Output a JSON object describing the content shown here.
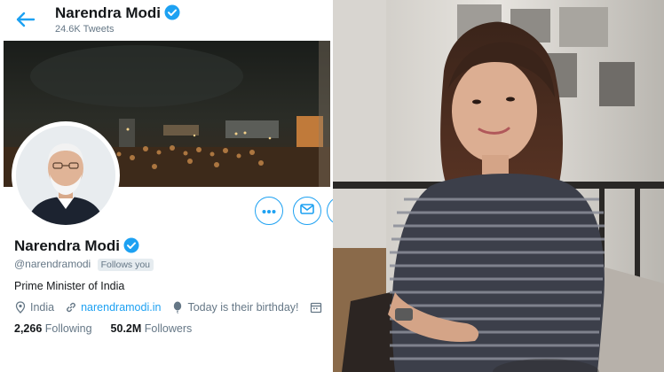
{
  "header": {
    "name": "Narendra Modi",
    "tweet_count": "24.6K Tweets"
  },
  "profile": {
    "name": "Narendra Modi",
    "handle": "@narendramodi",
    "follows_badge": "Follows you",
    "bio": "Prime Minister of India",
    "location": "India",
    "website": "narendramodi.in",
    "birthday_note": "Today is their birthday!",
    "following_count": "2,266",
    "following_label": "Following",
    "followers_count": "50.2M",
    "followers_label": "Followers"
  },
  "icons": {
    "back": "arrow-left-icon",
    "verified": "verified-badge-icon",
    "more": "more-icon",
    "message": "envelope-icon",
    "location": "location-pin-icon",
    "link": "link-icon",
    "balloon": "balloon-icon",
    "calendar": "calendar-icon"
  },
  "colors": {
    "accent": "#1da1f2",
    "text_primary": "#14171a",
    "text_secondary": "#657786"
  }
}
